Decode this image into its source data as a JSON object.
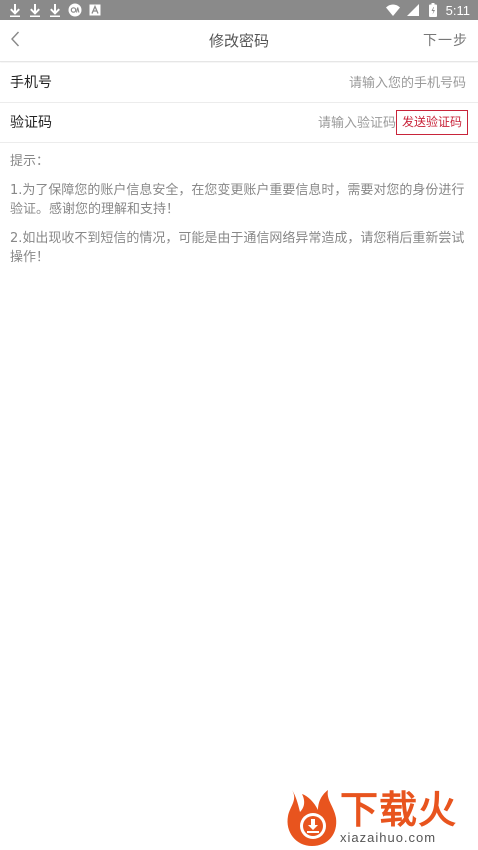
{
  "status_bar": {
    "time": "5:11",
    "left_icons": [
      "download-icon",
      "download-icon",
      "download-icon",
      "app-icon",
      "font-icon"
    ],
    "right_icons": [
      "wifi-icon",
      "signal-icon",
      "battery-icon"
    ]
  },
  "nav": {
    "back_icon": "chevron-left-icon",
    "title": "修改密码",
    "next_label": "下一步"
  },
  "form": {
    "phone": {
      "label": "手机号",
      "placeholder": "请输入您的手机号码",
      "value": ""
    },
    "code": {
      "label": "验证码",
      "placeholder": "请输入验证码",
      "value": "",
      "send_label": "发送验证码"
    }
  },
  "tips": {
    "title": "提示：",
    "items": [
      "1.为了保障您的账户信息安全，在您变更账户重要信息时，需要对您的身份进行验证。感谢您的理解和支持！",
      "2.如出现收不到短信的情况，可能是由于通信网络异常造成，请您稍后重新尝试操作！"
    ]
  },
  "watermark": {
    "brand": "下载火",
    "url": "xiazaihuo.com"
  },
  "colors": {
    "accent": "#c8243a",
    "status_bar": "#8a8a8a",
    "watermark": "#e8541e"
  }
}
